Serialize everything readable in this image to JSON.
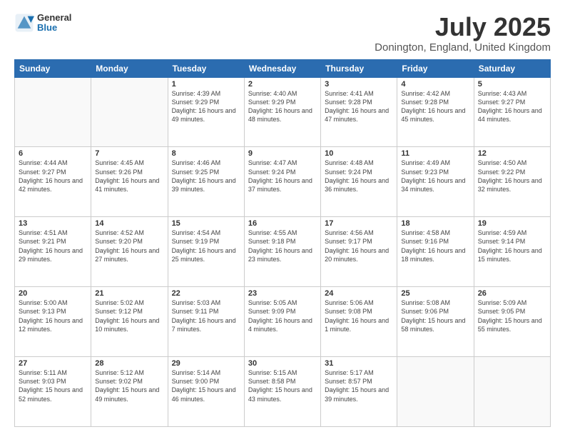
{
  "logo": {
    "line1": "General",
    "line2": "Blue"
  },
  "title": "July 2025",
  "subtitle": "Donington, England, United Kingdom",
  "days_of_week": [
    "Sunday",
    "Monday",
    "Tuesday",
    "Wednesday",
    "Thursday",
    "Friday",
    "Saturday"
  ],
  "weeks": [
    [
      {
        "day": "",
        "info": ""
      },
      {
        "day": "",
        "info": ""
      },
      {
        "day": "1",
        "sunrise": "4:39 AM",
        "sunset": "9:29 PM",
        "daylight": "16 hours and 49 minutes."
      },
      {
        "day": "2",
        "sunrise": "4:40 AM",
        "sunset": "9:29 PM",
        "daylight": "16 hours and 48 minutes."
      },
      {
        "day": "3",
        "sunrise": "4:41 AM",
        "sunset": "9:28 PM",
        "daylight": "16 hours and 47 minutes."
      },
      {
        "day": "4",
        "sunrise": "4:42 AM",
        "sunset": "9:28 PM",
        "daylight": "16 hours and 45 minutes."
      },
      {
        "day": "5",
        "sunrise": "4:43 AM",
        "sunset": "9:27 PM",
        "daylight": "16 hours and 44 minutes."
      }
    ],
    [
      {
        "day": "6",
        "sunrise": "4:44 AM",
        "sunset": "9:27 PM",
        "daylight": "16 hours and 42 minutes."
      },
      {
        "day": "7",
        "sunrise": "4:45 AM",
        "sunset": "9:26 PM",
        "daylight": "16 hours and 41 minutes."
      },
      {
        "day": "8",
        "sunrise": "4:46 AM",
        "sunset": "9:25 PM",
        "daylight": "16 hours and 39 minutes."
      },
      {
        "day": "9",
        "sunrise": "4:47 AM",
        "sunset": "9:24 PM",
        "daylight": "16 hours and 37 minutes."
      },
      {
        "day": "10",
        "sunrise": "4:48 AM",
        "sunset": "9:24 PM",
        "daylight": "16 hours and 36 minutes."
      },
      {
        "day": "11",
        "sunrise": "4:49 AM",
        "sunset": "9:23 PM",
        "daylight": "16 hours and 34 minutes."
      },
      {
        "day": "12",
        "sunrise": "4:50 AM",
        "sunset": "9:22 PM",
        "daylight": "16 hours and 32 minutes."
      }
    ],
    [
      {
        "day": "13",
        "sunrise": "4:51 AM",
        "sunset": "9:21 PM",
        "daylight": "16 hours and 29 minutes."
      },
      {
        "day": "14",
        "sunrise": "4:52 AM",
        "sunset": "9:20 PM",
        "daylight": "16 hours and 27 minutes."
      },
      {
        "day": "15",
        "sunrise": "4:54 AM",
        "sunset": "9:19 PM",
        "daylight": "16 hours and 25 minutes."
      },
      {
        "day": "16",
        "sunrise": "4:55 AM",
        "sunset": "9:18 PM",
        "daylight": "16 hours and 23 minutes."
      },
      {
        "day": "17",
        "sunrise": "4:56 AM",
        "sunset": "9:17 PM",
        "daylight": "16 hours and 20 minutes."
      },
      {
        "day": "18",
        "sunrise": "4:58 AM",
        "sunset": "9:16 PM",
        "daylight": "16 hours and 18 minutes."
      },
      {
        "day": "19",
        "sunrise": "4:59 AM",
        "sunset": "9:14 PM",
        "daylight": "16 hours and 15 minutes."
      }
    ],
    [
      {
        "day": "20",
        "sunrise": "5:00 AM",
        "sunset": "9:13 PM",
        "daylight": "16 hours and 12 minutes."
      },
      {
        "day": "21",
        "sunrise": "5:02 AM",
        "sunset": "9:12 PM",
        "daylight": "16 hours and 10 minutes."
      },
      {
        "day": "22",
        "sunrise": "5:03 AM",
        "sunset": "9:11 PM",
        "daylight": "16 hours and 7 minutes."
      },
      {
        "day": "23",
        "sunrise": "5:05 AM",
        "sunset": "9:09 PM",
        "daylight": "16 hours and 4 minutes."
      },
      {
        "day": "24",
        "sunrise": "5:06 AM",
        "sunset": "9:08 PM",
        "daylight": "16 hours and 1 minute."
      },
      {
        "day": "25",
        "sunrise": "5:08 AM",
        "sunset": "9:06 PM",
        "daylight": "15 hours and 58 minutes."
      },
      {
        "day": "26",
        "sunrise": "5:09 AM",
        "sunset": "9:05 PM",
        "daylight": "15 hours and 55 minutes."
      }
    ],
    [
      {
        "day": "27",
        "sunrise": "5:11 AM",
        "sunset": "9:03 PM",
        "daylight": "15 hours and 52 minutes."
      },
      {
        "day": "28",
        "sunrise": "5:12 AM",
        "sunset": "9:02 PM",
        "daylight": "15 hours and 49 minutes."
      },
      {
        "day": "29",
        "sunrise": "5:14 AM",
        "sunset": "9:00 PM",
        "daylight": "15 hours and 46 minutes."
      },
      {
        "day": "30",
        "sunrise": "5:15 AM",
        "sunset": "8:58 PM",
        "daylight": "15 hours and 43 minutes."
      },
      {
        "day": "31",
        "sunrise": "5:17 AM",
        "sunset": "8:57 PM",
        "daylight": "15 hours and 39 minutes."
      },
      {
        "day": "",
        "info": ""
      },
      {
        "day": "",
        "info": ""
      }
    ]
  ]
}
